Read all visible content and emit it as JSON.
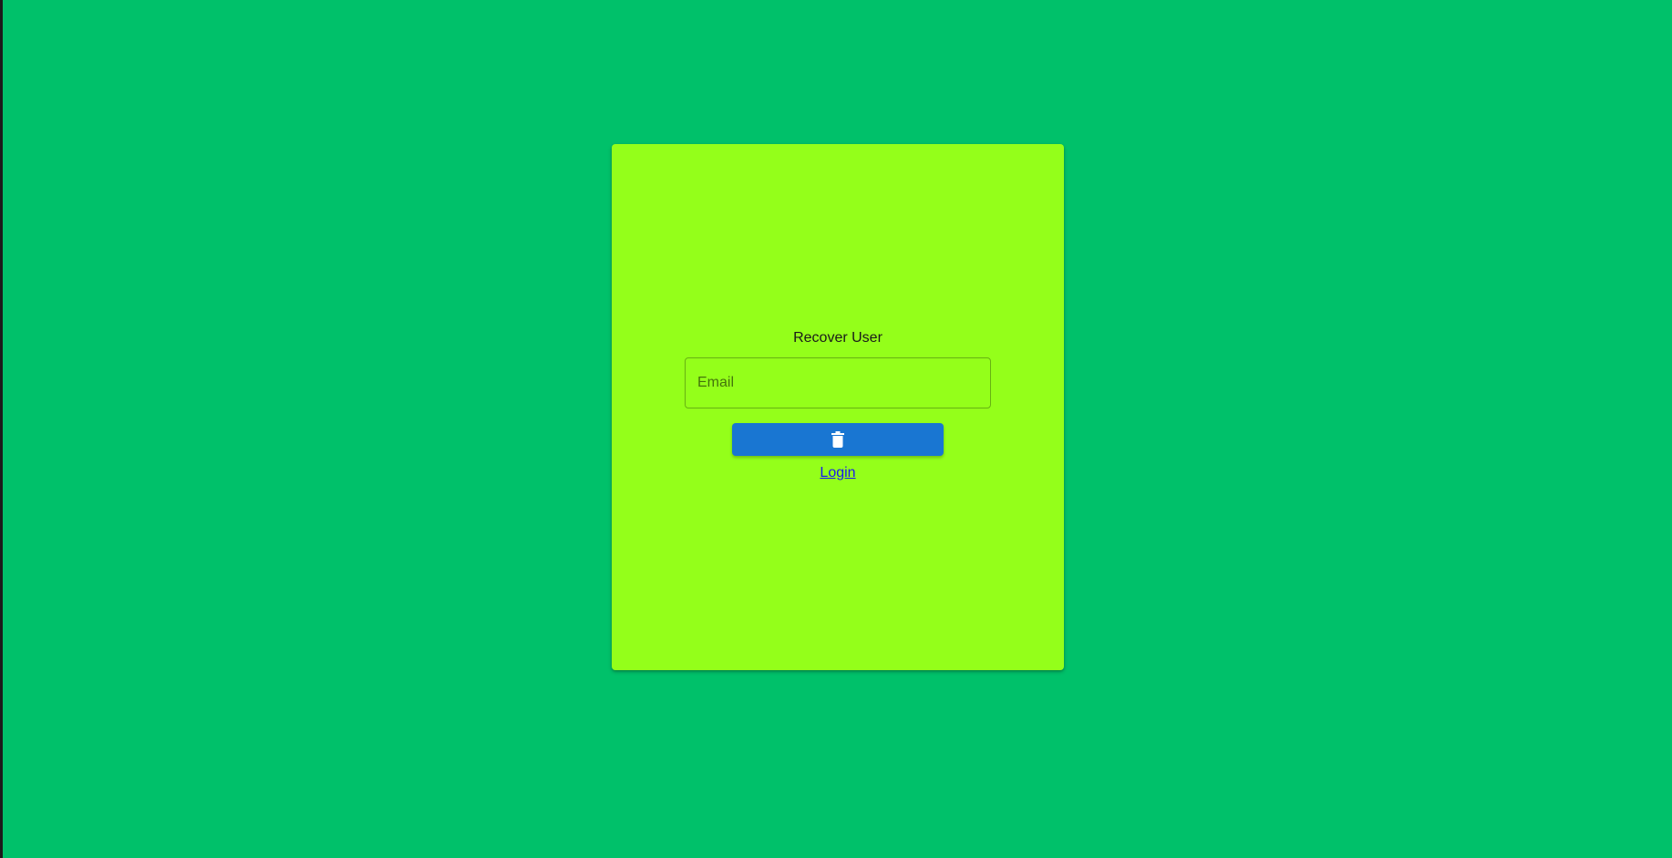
{
  "page": {
    "background_color": "#00c16a"
  },
  "card": {
    "background_color": "#94ff1a",
    "title": "Recover User",
    "email": {
      "placeholder": "Email",
      "value": ""
    },
    "recover_button": {
      "icon": "trash-icon",
      "color": "#1976d2"
    },
    "login_link": {
      "label": "Login"
    }
  }
}
